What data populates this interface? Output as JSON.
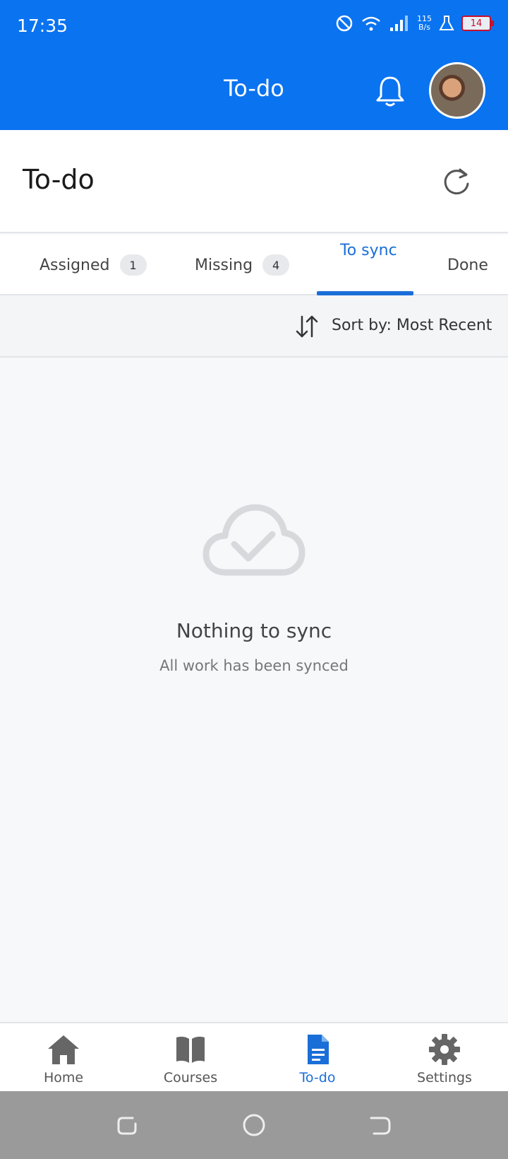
{
  "status_bar": {
    "time": "17:35",
    "net_speed_value": "115",
    "net_speed_unit": "B/s",
    "battery_level": "14",
    "icons": [
      "dnd-icon",
      "wifi-icon",
      "signal-icon",
      "flask-icon",
      "battery-icon"
    ]
  },
  "app_bar": {
    "title": "To-do",
    "icons": [
      "bell-icon",
      "avatar"
    ]
  },
  "header": {
    "title": "To-do"
  },
  "tabs": [
    {
      "label": "Assigned",
      "count": "1"
    },
    {
      "label": "Missing",
      "count": "4"
    },
    {
      "label": "To sync",
      "active": true
    },
    {
      "label": "Done"
    }
  ],
  "sort": {
    "label": "Sort by: Most Recent"
  },
  "empty_state": {
    "title": "Nothing to sync",
    "subtitle": "All work has been synced"
  },
  "bottom_nav": [
    {
      "label": "Home",
      "icon": "home-icon"
    },
    {
      "label": "Courses",
      "icon": "book-icon"
    },
    {
      "label": "To-do",
      "icon": "document-icon",
      "active": true
    },
    {
      "label": "Settings",
      "icon": "gear-icon"
    }
  ],
  "colors": {
    "primary": "#0a73f0",
    "accent": "#1a6ed8",
    "background": "#f7f8fa",
    "system_nav": "#9a9a9a"
  }
}
